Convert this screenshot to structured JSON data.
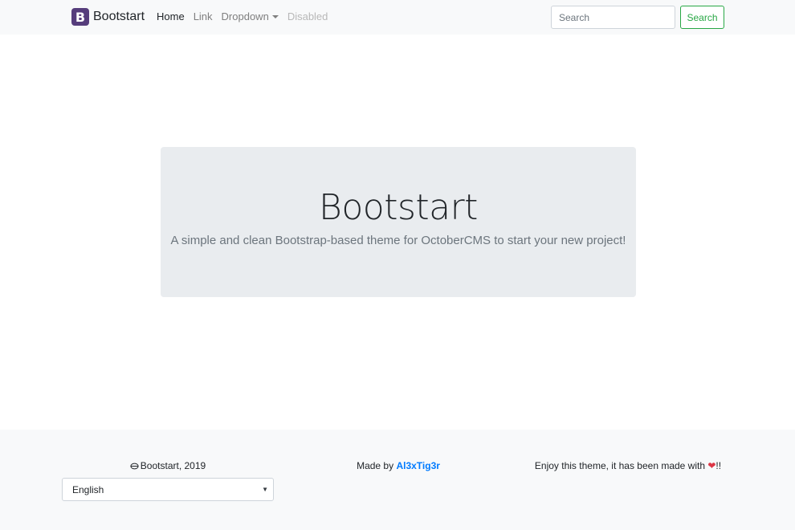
{
  "navbar": {
    "brand_letter": "B",
    "brand_name": "Bootstart",
    "items": [
      {
        "label": "Home"
      },
      {
        "label": "Link"
      },
      {
        "label": "Dropdown"
      },
      {
        "label": "Disabled"
      }
    ],
    "search_placeholder": "Search",
    "search_button": "Search"
  },
  "jumbotron": {
    "title": "Bootstart",
    "lead": "A simple and clean Bootstrap-based theme for OctoberCMS to start your new project!"
  },
  "footer": {
    "copyright": "Bootstart, 2019",
    "made_by_prefix": "Made by ",
    "author": "Al3xTig3r",
    "enjoy_text": "Enjoy this theme, it has been made with ",
    "enjoy_suffix": "!!",
    "language_selected": "English"
  },
  "colors": {
    "brand": "#563d7c",
    "success": "#28a745",
    "link": "#007bff",
    "heart": "#dc3545"
  }
}
